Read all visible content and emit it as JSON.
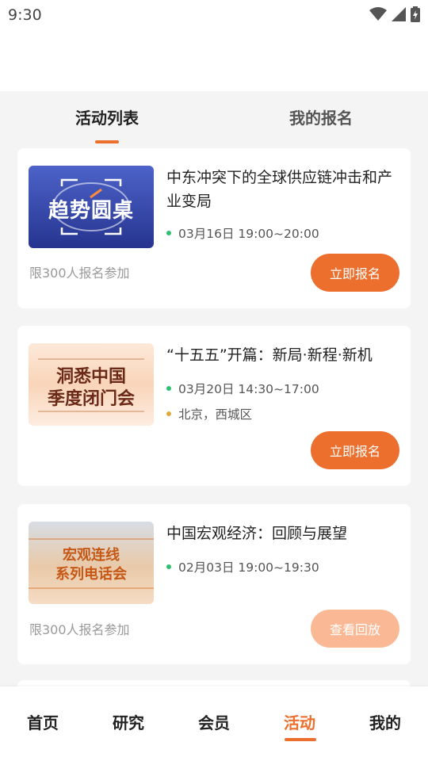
{
  "status": {
    "time": "9:30"
  },
  "tabs": [
    {
      "label": "活动列表"
    },
    {
      "label": "我的报名"
    }
  ],
  "events": [
    {
      "title": "中东冲突下的全球供应链冲击和产业变局",
      "thumb_text": "趋势圆桌",
      "datetime": "03月16日 19:00~20:00",
      "limit": "限300人报名参加",
      "button": "立即报名"
    },
    {
      "title": "“十五五”开篇：新局·新程·新机",
      "thumb_text_line1": "洞悉中国",
      "thumb_text_line2": "季度闭门会",
      "datetime": "03月20日 14:30~17:00",
      "location": "北京，西城区",
      "button": "立即报名"
    },
    {
      "title": "中国宏观经济：回顾与展望",
      "thumb_text_line1": "宏观连线",
      "thumb_text_line2": "系列电话会",
      "datetime": "02月03日 19:00~19:30",
      "limit": "限300人报名参加",
      "button": "查看回放"
    }
  ],
  "nav": [
    {
      "label": "首页"
    },
    {
      "label": "研究"
    },
    {
      "label": "会员"
    },
    {
      "label": "活动"
    },
    {
      "label": "我的"
    }
  ],
  "colors": {
    "accent": "#ec6f2d",
    "accent_disabled": "#fbb895",
    "time_dot": "#2fbf71",
    "location_dot": "#e0a93a"
  }
}
